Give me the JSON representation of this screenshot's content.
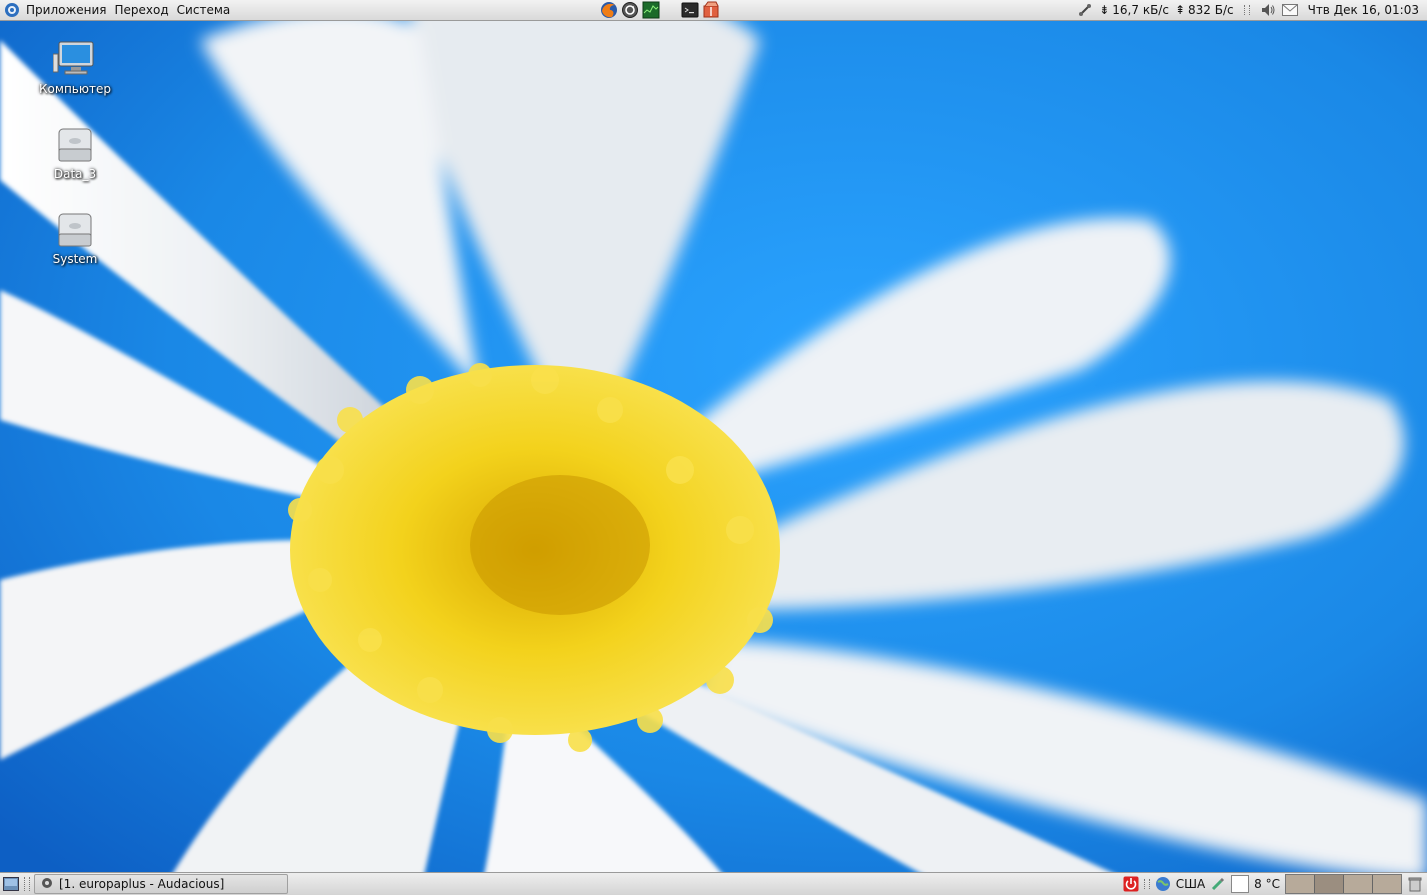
{
  "top_panel": {
    "menus": [
      "Приложения",
      "Переход",
      "Система"
    ],
    "launchers": [
      "firefox-icon",
      "update-manager-icon",
      "system-monitor-icon",
      "terminal-icon",
      "archive-manager-icon"
    ],
    "network": {
      "down": "16,7 кБ/с",
      "up": "832 Б/с"
    },
    "clock": "Чтв Дек 16, 01:03"
  },
  "desktop": {
    "icons": [
      {
        "label": "Компьютер",
        "icon": "computer-icon"
      },
      {
        "label": "Data_3",
        "icon": "drive-icon"
      },
      {
        "label": "System",
        "icon": "drive-icon"
      }
    ]
  },
  "bottom_panel": {
    "task": "[1. europaplus - Audacious]",
    "keyboard_layout": "США",
    "temperature": "8 °C",
    "workspaces": 4,
    "active_workspace": 2
  },
  "colors": {
    "sky": "#1a8ee8",
    "petal": "#f4f6f8",
    "center": "#f2cf12",
    "panel": "#e3e3e3"
  }
}
